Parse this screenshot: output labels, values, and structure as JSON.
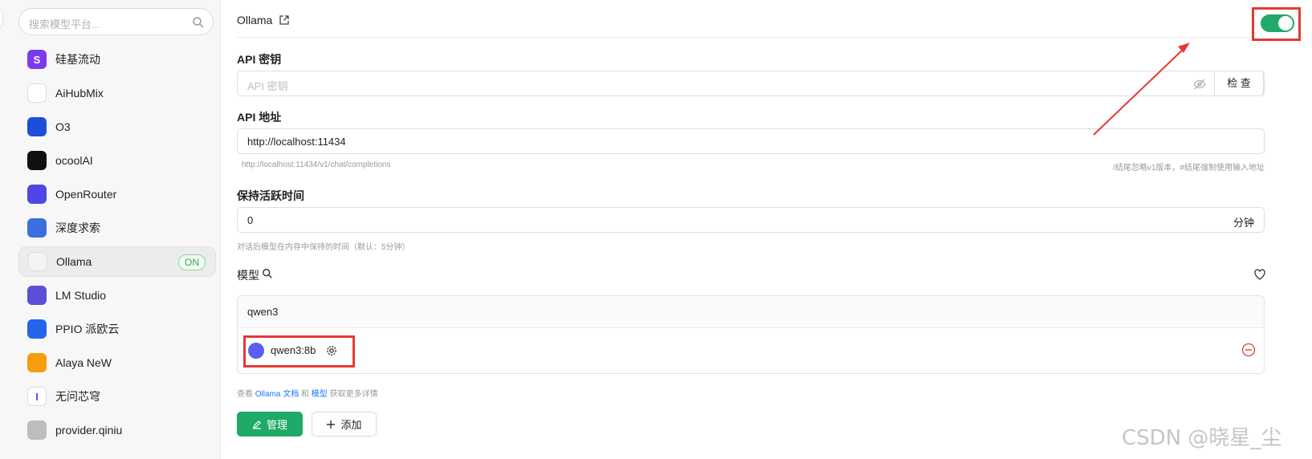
{
  "sidebar": {
    "search_placeholder": "搜索模型平台...",
    "providers": [
      {
        "name": "硅基流动",
        "logo": "silicon-flow-logo",
        "logo_color": "#7c3aed",
        "logo_text": "S"
      },
      {
        "name": "AiHubMix",
        "logo": "aihubmix-logo",
        "logo_color": "#ffffff",
        "logo_text": ""
      },
      {
        "name": "O3",
        "logo": "o3-logo",
        "logo_color": "#1d4ed8",
        "logo_text": ""
      },
      {
        "name": "ocoolAI",
        "logo": "ocoolai-logo",
        "logo_color": "#111111",
        "logo_text": ""
      },
      {
        "name": "OpenRouter",
        "logo": "openrouter-logo",
        "logo_color": "#4f46e5",
        "logo_text": ""
      },
      {
        "name": "深度求索",
        "logo": "deepseek-logo",
        "logo_color": "#3b6fe0",
        "logo_text": ""
      },
      {
        "name": "Ollama",
        "logo": "ollama-logo",
        "logo_color": "#f3f3f3",
        "logo_text": "",
        "badge": "ON",
        "active": true
      },
      {
        "name": "LM Studio",
        "logo": "lm-studio-logo",
        "logo_color": "#5b4fd6",
        "logo_text": ""
      },
      {
        "name": "PPIO 派欧云",
        "logo": "ppio-logo",
        "logo_color": "#2563eb",
        "logo_text": ""
      },
      {
        "name": "Alaya NeW",
        "logo": "alaya-logo",
        "logo_color": "#f59e0b",
        "logo_text": ""
      },
      {
        "name": "无问芯穹",
        "logo": "infini-logo",
        "logo_color": "#ffffff",
        "logo_text": "I"
      },
      {
        "name": "provider.qiniu",
        "logo": "qiniu-logo",
        "logo_color": "#bdbdbd",
        "logo_text": ""
      }
    ]
  },
  "header": {
    "title": "Ollama",
    "enabled": true
  },
  "api_key": {
    "label": "API 密钥",
    "placeholder": "API 密钥",
    "check_label": "检 查"
  },
  "api_url": {
    "label": "API 地址",
    "value": "http://localhost:11434",
    "hint_left": "http://localhost:11434/v1/chat/completions",
    "hint_right": "/结尾忽略v1版本，#结尾强制使用输入地址"
  },
  "keep_alive": {
    "label": "保持活跃时间",
    "value": "0",
    "unit": "分钟",
    "hint": "对话后模型在内存中保持的时间（默认：5分钟）"
  },
  "models": {
    "label": "模型",
    "groups": [
      {
        "name": "qwen3",
        "items": [
          {
            "name": "qwen3:8b"
          }
        ]
      }
    ]
  },
  "more_info": {
    "prefix": "查看",
    "link1": "Ollama 文档",
    "and": "和",
    "link2": "模型",
    "suffix": "获取更多详情"
  },
  "actions": {
    "manage_label": "管理",
    "add_label": "添加"
  },
  "watermark": "CSDN @晓星_尘",
  "colors": {
    "accent": "#1faa67",
    "highlight": "#e53935",
    "link": "#1677ff"
  }
}
